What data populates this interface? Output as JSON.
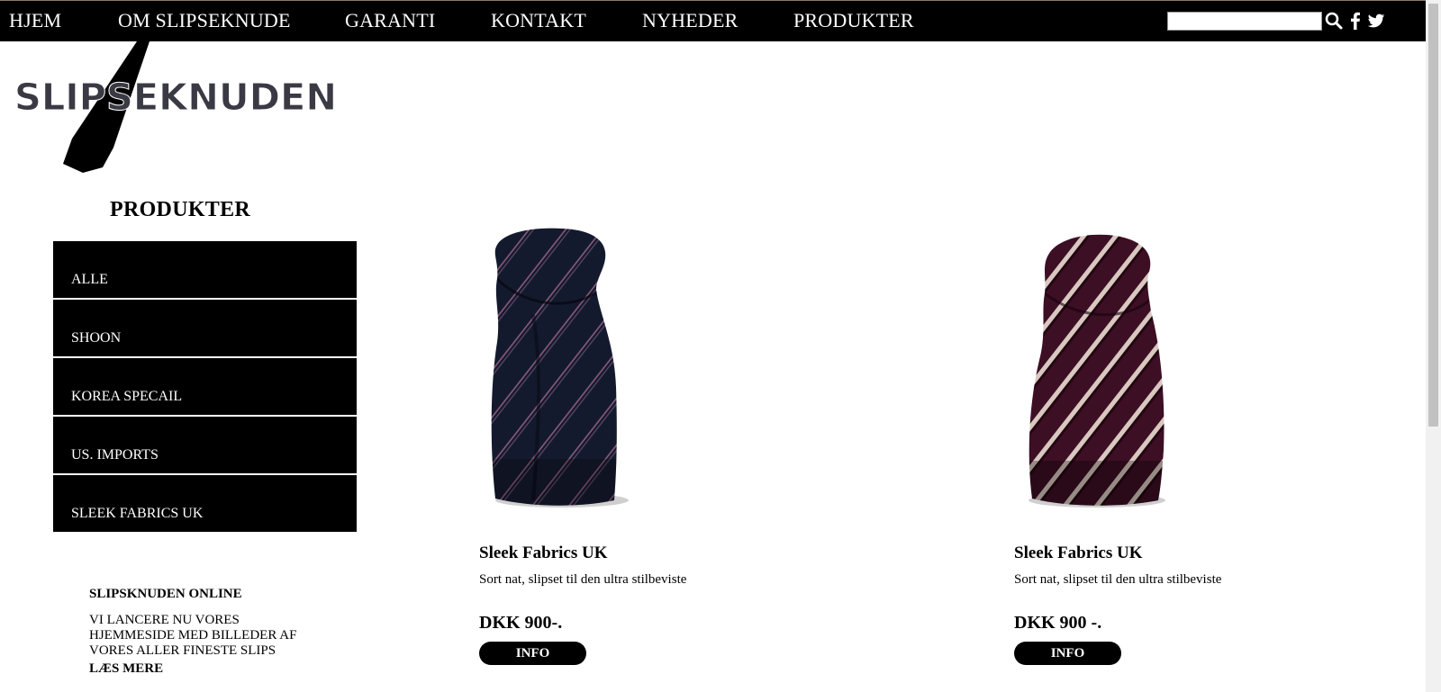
{
  "nav": {
    "items": [
      "HJEM",
      "OM SLIPSEKNUDE",
      "GARANTI",
      "KONTAKT",
      "NYHEDER",
      "PRODUKTER"
    ],
    "search_value": ""
  },
  "logo": {
    "text": "SLIPSEKNUDEN"
  },
  "sidebar": {
    "title": "PRODUKTER",
    "items": [
      "ALLE",
      "SHOON",
      "KOREA SPECAIL",
      "US. IMPORTS",
      "SLEEK FABRICS UK"
    ]
  },
  "news": {
    "title": "SLIPSKNUDEN ONLINE",
    "body": "VI LANCERE NU VORES HJEMMESIDE MED BILLEDER AF VORES ALLER FINESTE SLIPS",
    "more": "LÆS MERE"
  },
  "products": [
    {
      "name": "Sleek Fabrics UK",
      "desc": "Sort nat, slipset til den ultra stilbeviste",
      "price": "DKK 900-.",
      "button": "INFO",
      "image": "navy-striped-tie"
    },
    {
      "name": "Sleek Fabrics UK",
      "desc": "Sort nat, slipset til den ultra stilbeviste",
      "price": "DKK 900 -.",
      "button": "INFO",
      "image": "burgundy-striped-tie"
    }
  ],
  "colors": {
    "nav_bg": "#000000",
    "page_bg": "#ffffff",
    "logo_text": "#3a3a44",
    "tie_navy": "#141a2e",
    "tie_burgundy": "#3d0f24"
  },
  "icons": [
    "search-icon",
    "facebook-icon",
    "twitter-icon"
  ]
}
